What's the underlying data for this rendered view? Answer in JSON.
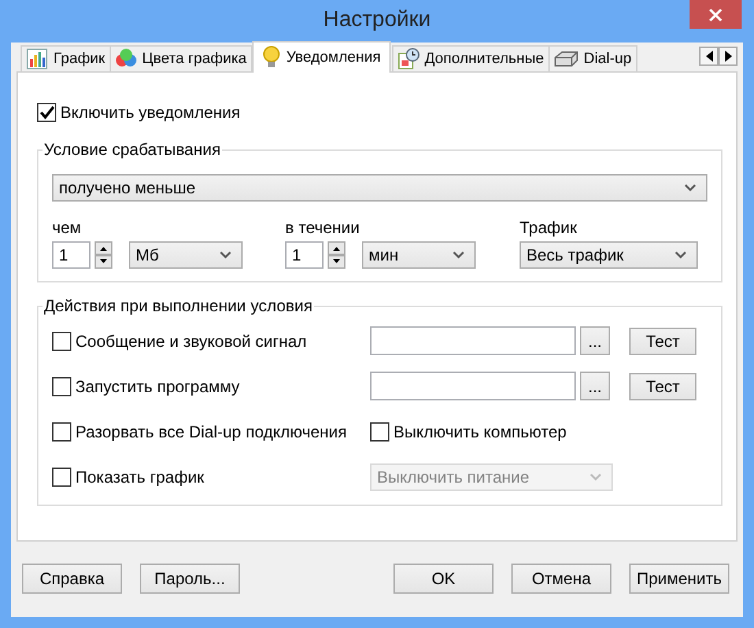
{
  "window": {
    "title": "Настройки"
  },
  "tabs": [
    {
      "label": "График",
      "selected": false
    },
    {
      "label": "Цвета графика",
      "selected": false
    },
    {
      "label": "Уведомления",
      "selected": true
    },
    {
      "label": "Дополнительные",
      "selected": false
    },
    {
      "label": "Dial-up",
      "selected": false
    }
  ],
  "enable": {
    "label": "Включить уведомления",
    "checked": true
  },
  "condition": {
    "title": "Условие срабатывания",
    "mode": "получено меньше",
    "amount": {
      "label": "чем",
      "value": "1",
      "unit": "Мб"
    },
    "period": {
      "label": "в течении",
      "value": "1",
      "unit": "мин"
    },
    "traffic": {
      "label": "Трафик",
      "value": "Весь трафик"
    }
  },
  "actions": {
    "title": "Действия при выполнении условия",
    "rows": [
      {
        "kind": "file",
        "label": "Сообщение и звуковой сигнал",
        "checked": false,
        "browse": "...",
        "test": "Тест"
      },
      {
        "kind": "file",
        "label": "Запустить программу",
        "checked": false,
        "browse": "...",
        "test": "Тест"
      },
      {
        "kind": "pair",
        "label": "Разорвать все Dial-up подключения",
        "checked": false,
        "label2": "Выключить компьютер",
        "checked2": false
      },
      {
        "kind": "select",
        "label": "Показать график",
        "checked": false,
        "select": "Выключить питание",
        "disabled": true
      }
    ]
  },
  "buttons_left": [
    "Справка",
    "Пароль..."
  ],
  "buttons_right": [
    "OK",
    "Отмена",
    "Применить"
  ]
}
